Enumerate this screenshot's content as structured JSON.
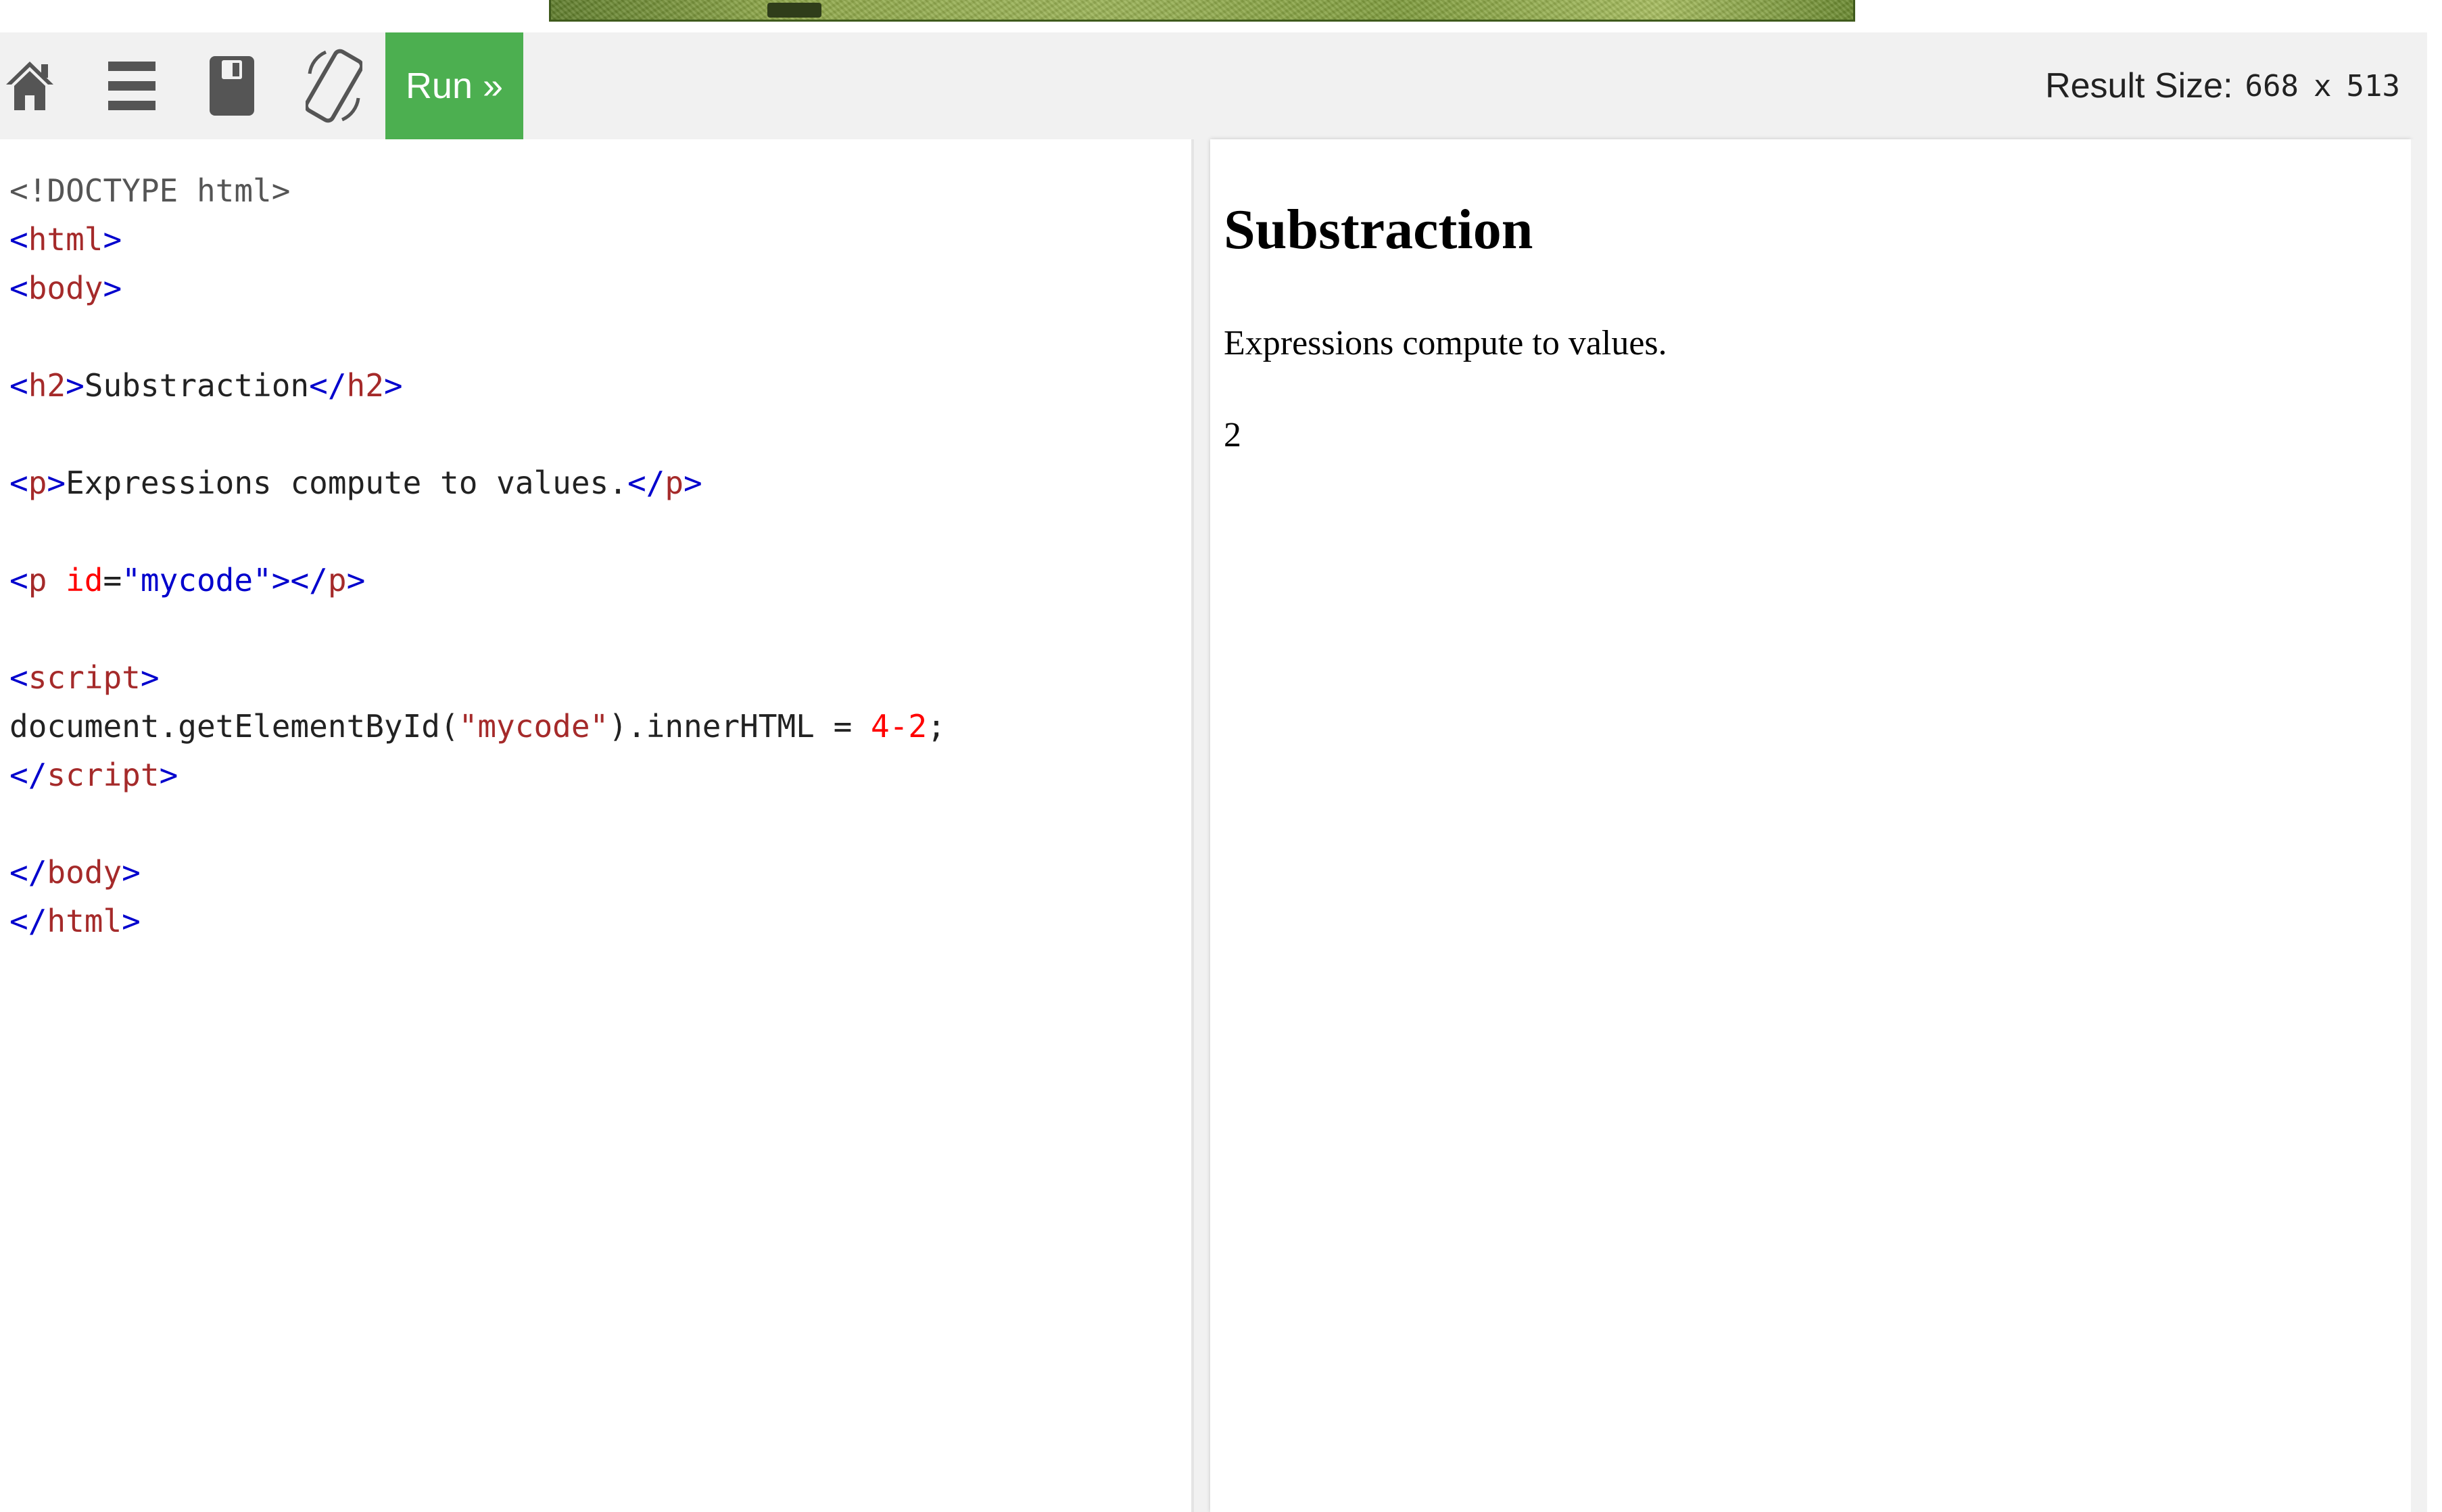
{
  "toolbar": {
    "icons": {
      "home": "home-icon",
      "menu": "menu-icon",
      "save": "save-icon",
      "rotate": "rotate-icon"
    },
    "run_label": "Run »",
    "result_size_label": "Result Size:",
    "result_width": "668",
    "result_times": "x",
    "result_height": "513",
    "run_color": "#4caf50"
  },
  "editor": {
    "lines": [
      [
        {
          "t": "doctype",
          "v": "<!DOCTYPE html>"
        }
      ],
      [
        {
          "t": "br",
          "v": "<"
        },
        {
          "t": "tag",
          "v": "html"
        },
        {
          "t": "br",
          "v": ">"
        }
      ],
      [
        {
          "t": "br",
          "v": "<"
        },
        {
          "t": "tag",
          "v": "body"
        },
        {
          "t": "br",
          "v": ">"
        }
      ],
      [],
      [
        {
          "t": "br",
          "v": "<"
        },
        {
          "t": "tag",
          "v": "h2"
        },
        {
          "t": "br",
          "v": ">"
        },
        {
          "t": "plain",
          "v": "Substraction"
        },
        {
          "t": "br",
          "v": "</"
        },
        {
          "t": "tag",
          "v": "h2"
        },
        {
          "t": "br",
          "v": ">"
        }
      ],
      [],
      [
        {
          "t": "br",
          "v": "<"
        },
        {
          "t": "tag",
          "v": "p"
        },
        {
          "t": "br",
          "v": ">"
        },
        {
          "t": "plain",
          "v": "Expressions compute to values."
        },
        {
          "t": "br",
          "v": "</"
        },
        {
          "t": "tag",
          "v": "p"
        },
        {
          "t": "br",
          "v": ">"
        }
      ],
      [],
      [
        {
          "t": "br",
          "v": "<"
        },
        {
          "t": "tag",
          "v": "p"
        },
        {
          "t": "plain",
          "v": " "
        },
        {
          "t": "attr",
          "v": "id"
        },
        {
          "t": "plain",
          "v": "="
        },
        {
          "t": "br",
          "v": "\"mycode\""
        },
        {
          "t": "br",
          "v": "></"
        },
        {
          "t": "tag",
          "v": "p"
        },
        {
          "t": "br",
          "v": ">"
        }
      ],
      [],
      [
        {
          "t": "br",
          "v": "<"
        },
        {
          "t": "tag",
          "v": "script"
        },
        {
          "t": "br",
          "v": ">"
        }
      ],
      [
        {
          "t": "plain",
          "v": "document.getElementById("
        },
        {
          "t": "str",
          "v": "\"mycode\""
        },
        {
          "t": "plain",
          "v": ").innerHTML = "
        },
        {
          "t": "num",
          "v": "4"
        },
        {
          "t": "attr",
          "v": "-"
        },
        {
          "t": "num",
          "v": "2"
        },
        {
          "t": "plain",
          "v": ";"
        }
      ],
      [
        {
          "t": "br",
          "v": "</"
        },
        {
          "t": "tag",
          "v": "script"
        },
        {
          "t": "br",
          "v": ">"
        }
      ],
      [],
      [
        {
          "t": "br",
          "v": "</"
        },
        {
          "t": "tag",
          "v": "body"
        },
        {
          "t": "br",
          "v": ">"
        }
      ],
      [
        {
          "t": "br",
          "v": "</"
        },
        {
          "t": "tag",
          "v": "html"
        },
        {
          "t": "br",
          "v": ">"
        }
      ]
    ]
  },
  "result": {
    "heading": "Substraction",
    "paragraph": "Expressions compute to values.",
    "output": "2"
  }
}
